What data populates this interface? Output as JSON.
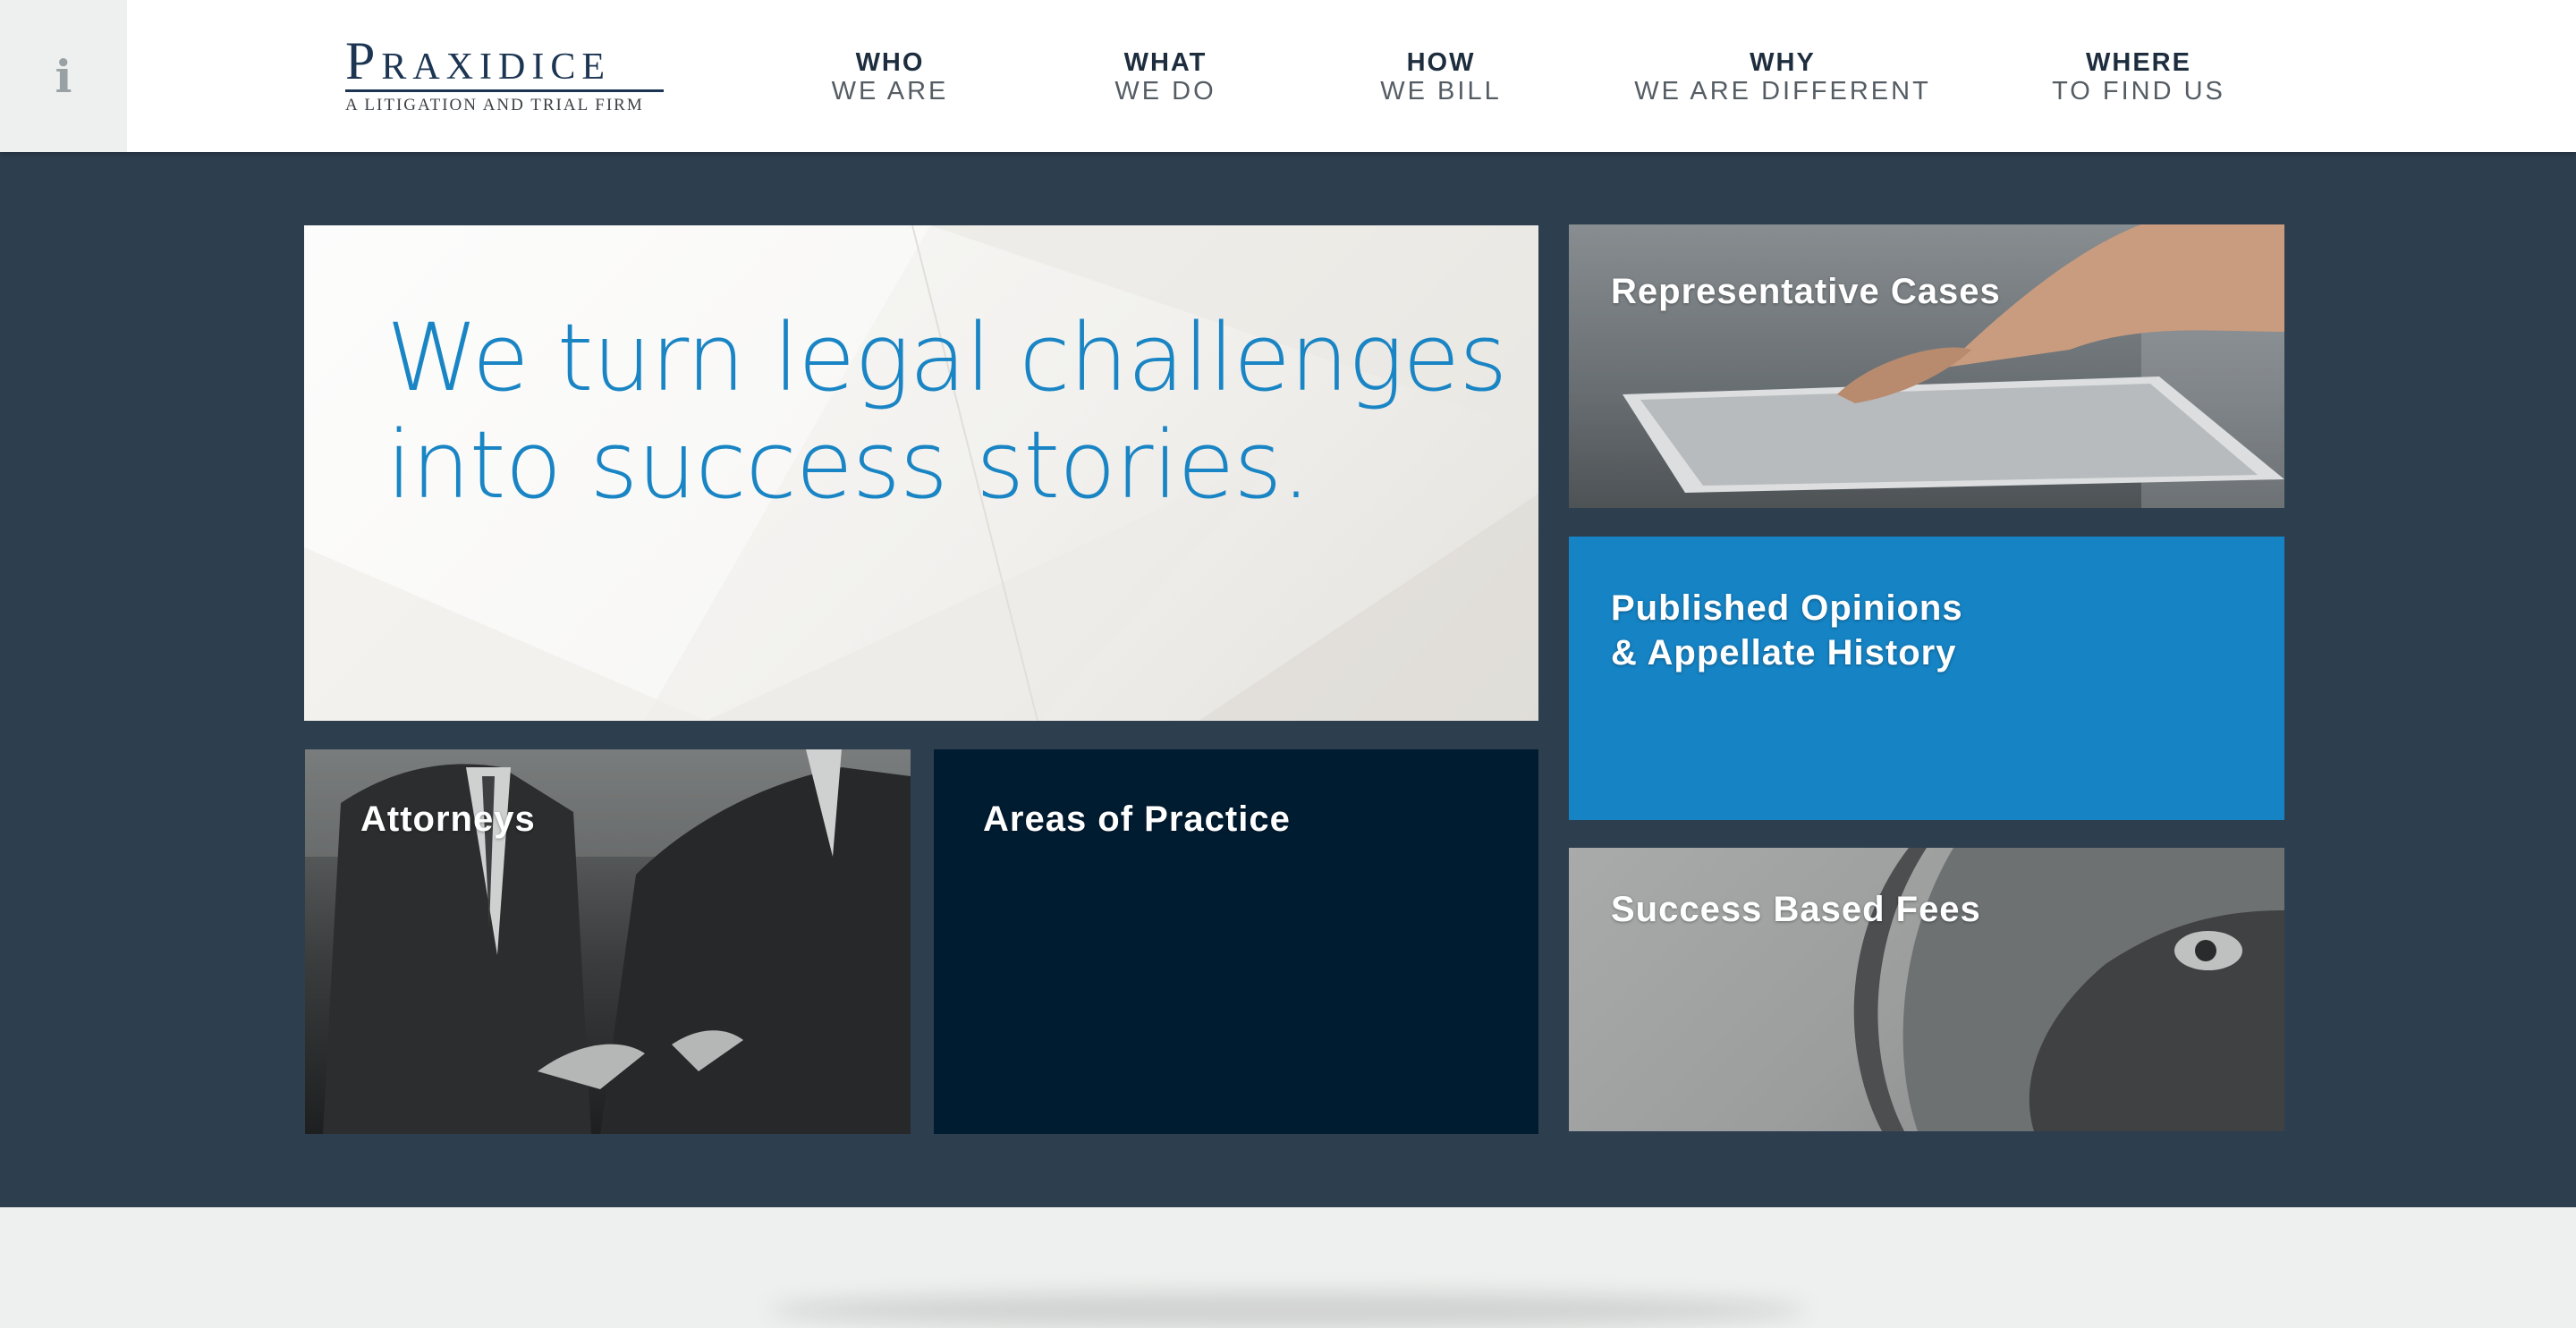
{
  "header": {
    "info_button_glyph": "i",
    "logo": {
      "name": "Praxidice",
      "tagline": "A LITIGATION AND TRIAL FIRM"
    },
    "nav": [
      {
        "top": "WHO",
        "bottom": "WE ARE"
      },
      {
        "top": "WHAT",
        "bottom": "WE DO"
      },
      {
        "top": "HOW",
        "bottom": "WE BILL"
      },
      {
        "top": "WHY",
        "bottom": "WE ARE DIFFERENT"
      },
      {
        "top": "WHERE",
        "bottom": "TO FIND US"
      }
    ]
  },
  "hero": {
    "tagline": "We turn legal challenges\ninto success stories."
  },
  "tiles": {
    "representative_cases": "Representative Cases",
    "published_opinions": "Published Opinions\n& Appellate History",
    "success_based_fees": "Success Based Fees",
    "attorneys": "Attorneys",
    "areas_of_practice": "Areas of Practice"
  },
  "colors": {
    "header_bg": "#ffffff",
    "band_bg": "#2d3e4f",
    "accent_blue": "#1583c4",
    "tagline_blue": "#1a85c4",
    "navy_tile": "#001c31",
    "logo_navy": "#1c3553"
  },
  "icons": {
    "info": "info-icon"
  }
}
